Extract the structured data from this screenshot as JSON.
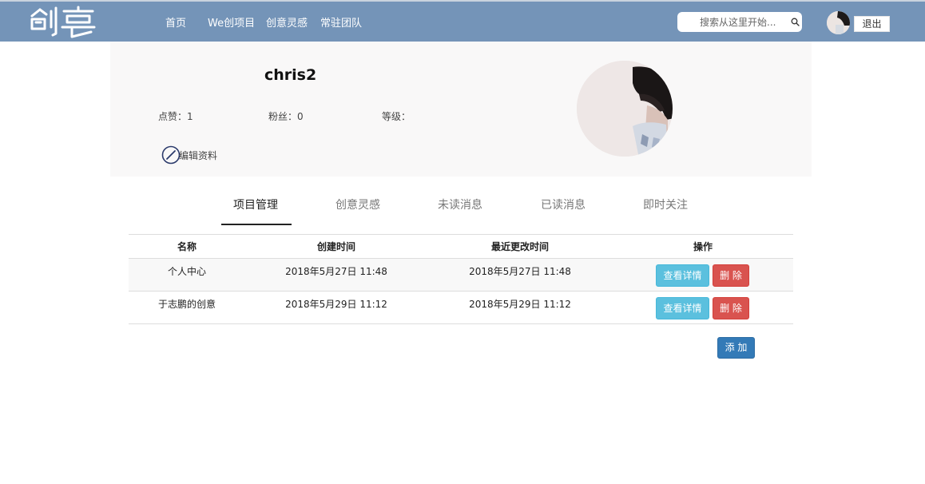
{
  "header": {
    "nav": [
      "首页",
      "We创项目",
      "创意灵感",
      "常驻团队"
    ],
    "search_placeholder": "搜索从这里开始...",
    "logout_label": "退出"
  },
  "profile": {
    "username": "chris2",
    "stats": {
      "likes": "点赞：1",
      "fans": "粉丝：0",
      "level": "等级："
    },
    "edit_label": "编辑资料"
  },
  "tabs": [
    {
      "label": "项目管理",
      "active": true
    },
    {
      "label": "创意灵感",
      "active": false
    },
    {
      "label": "未读消息",
      "active": false
    },
    {
      "label": "已读消息",
      "active": false
    },
    {
      "label": "即时关注",
      "active": false
    }
  ],
  "table": {
    "headers": [
      "名称",
      "创建时间",
      "最近更改时间",
      "操作"
    ],
    "rows": [
      {
        "name": "个人中心",
        "created": "2018年5月27日 11:48",
        "modified": "2018年5月27日 11:48"
      },
      {
        "name": "于志鹏的创意",
        "created": "2018年5月29日 11:12",
        "modified": "2018年5月29日 11:12"
      }
    ],
    "detail_label": "查看详情",
    "delete_label": "删 除",
    "add_label": "添 加"
  },
  "colors": {
    "topbar": "#7494b8",
    "info": "#5bc0de",
    "danger": "#d9534f",
    "primary": "#337ab7"
  }
}
